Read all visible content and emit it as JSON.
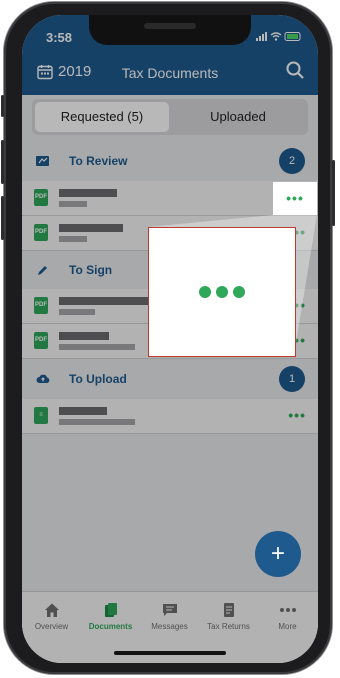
{
  "status_bar": {
    "time": "3:58"
  },
  "header": {
    "year": "2019",
    "title": "Tax Documents"
  },
  "segments": {
    "requested": "Requested (5)",
    "uploaded": "Uploaded"
  },
  "sections": {
    "review": {
      "label": "To Review",
      "count": "2"
    },
    "sign": {
      "label": "To Sign"
    },
    "upload": {
      "label": "To Upload",
      "count": "1"
    }
  },
  "row_more_label": "•••",
  "fab_label": "+",
  "tabs": [
    {
      "label": "Overview",
      "icon": "home-icon"
    },
    {
      "label": "Documents",
      "icon": "documents-icon"
    },
    {
      "label": "Messages",
      "icon": "messages-icon"
    },
    {
      "label": "Tax Returns",
      "icon": "tax-returns-icon"
    },
    {
      "label": "More",
      "icon": "more-icon"
    }
  ],
  "colors": {
    "brand_blue": "#1f5a8f",
    "accent_green": "#2fa85a",
    "highlight_border": "#c0392b"
  }
}
